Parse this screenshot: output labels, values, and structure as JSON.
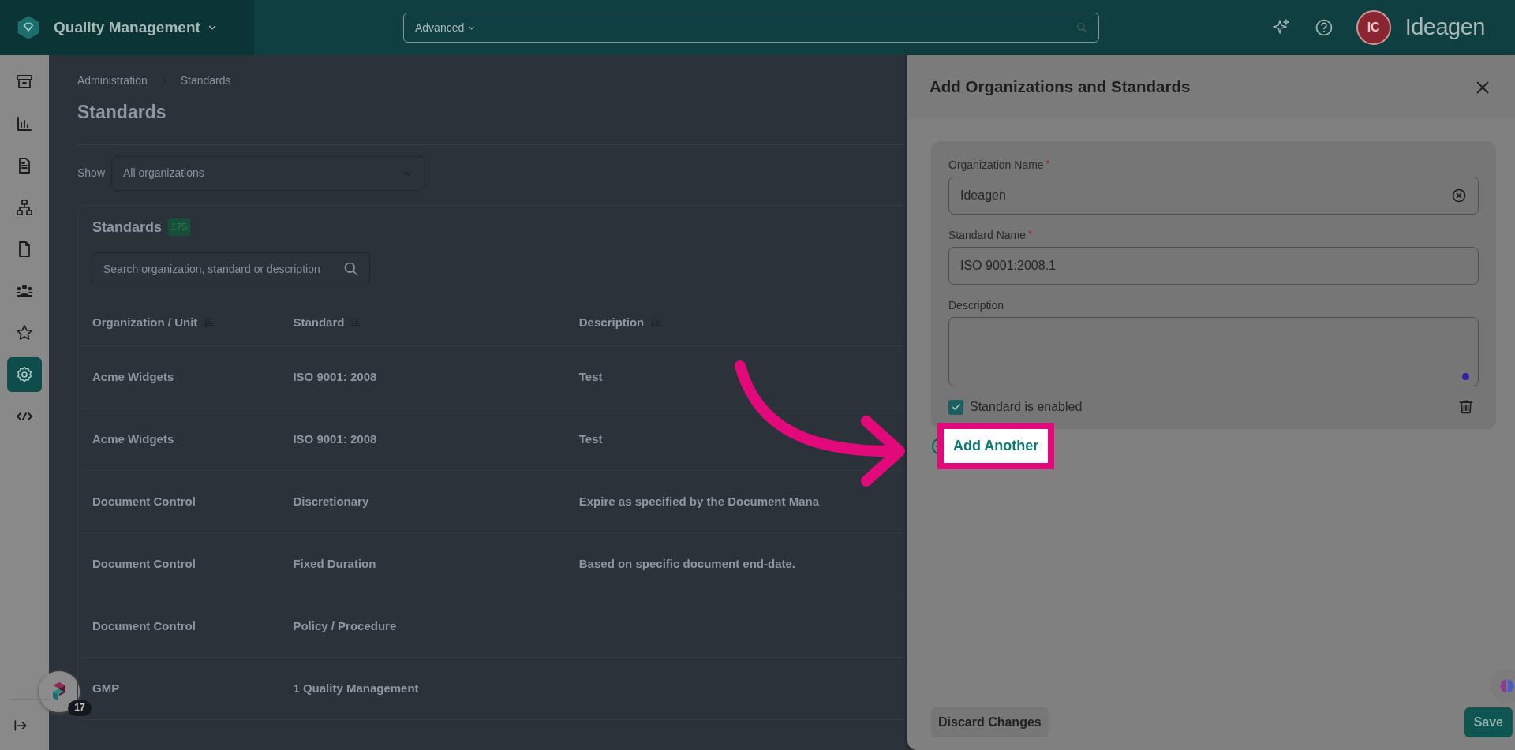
{
  "header": {
    "app_name": "Quality Management",
    "search": {
      "scope": "Advanced"
    },
    "avatar": "IC",
    "brand": "Ideagen"
  },
  "sidebar": {
    "items": [
      {
        "selected": false
      },
      {
        "selected": false
      },
      {
        "selected": false
      },
      {
        "selected": false
      },
      {
        "selected": false
      },
      {
        "selected": false
      },
      {
        "selected": false
      },
      {
        "selected": true
      },
      {
        "selected": false
      }
    ]
  },
  "assistant_widget": {
    "badge": "17"
  },
  "breadcrumb": [
    "Administration",
    "Standards"
  ],
  "page_title": "Standards",
  "filter": {
    "label": "Show",
    "value": "All organizations"
  },
  "standards": {
    "title": "Standards",
    "count": "175",
    "search": {
      "placeholder": "Search organization, standard or description"
    },
    "columns": [
      "Organization / Unit",
      "Standard",
      "Description"
    ],
    "rows": [
      {
        "organization": "Acme Widgets",
        "standard": "ISO 9001: 2008",
        "description": "Test"
      },
      {
        "organization": "Acme Widgets",
        "standard": "ISO 9001: 2008",
        "description": "Test"
      },
      {
        "organization": "Document Control",
        "standard": "Discretionary",
        "description": "Expire as specified by the Document Mana"
      },
      {
        "organization": "Document Control",
        "standard": "Fixed Duration",
        "description": "Based on specific document end-date."
      },
      {
        "organization": "Document Control",
        "standard": "Policy / Procedure"
      },
      {
        "organization": "GMP",
        "standard": "1 Quality Management"
      }
    ]
  },
  "panel": {
    "title": "Add Organizations and Standards",
    "fields": [
      {
        "kind": "input",
        "label": "Organization Name",
        "required_mark": "*",
        "value": "Ideagen",
        "clearable": true
      },
      {
        "kind": "input",
        "label": "Standard Name",
        "required_mark": "*",
        "value": "ISO 9001:2008.1",
        "clearable": false
      },
      {
        "kind": "textarea",
        "label": "Description"
      }
    ],
    "enabled": {
      "label": "Standard is enabled",
      "checked": true
    },
    "add_another": "Add Another",
    "discard": "Discard Changes",
    "save": "Save"
  }
}
